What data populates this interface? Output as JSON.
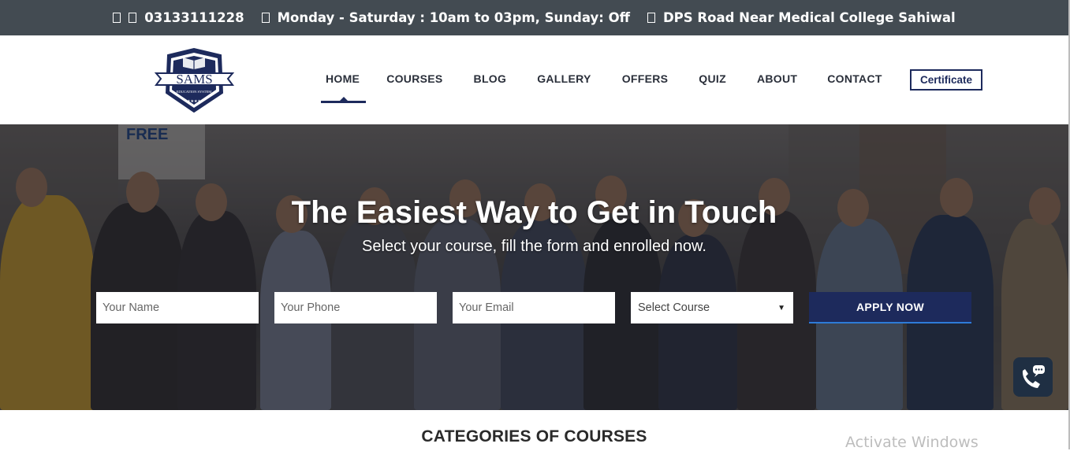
{
  "topbar": {
    "phone": "03133111228",
    "hours": "Monday - Saturday : 10am to 03pm, Sunday: Off",
    "address": "DPS Road Near Medical College Sahiwal"
  },
  "logo": {
    "title": "SAMS",
    "subtitle": "EDUCATION SYSTEM"
  },
  "nav": {
    "items": [
      "HOME",
      "COURSES",
      "BLOG",
      "GALLERY",
      "OFFERS",
      "QUIZ",
      "ABOUT",
      "CONTACT"
    ],
    "active": "HOME",
    "certificate_label": "Certificate"
  },
  "hero": {
    "title": "The Easiest Way to Get in Touch",
    "subtitle": "Select your course, fill the form and enrolled now.",
    "form": {
      "name_placeholder": "Your Name",
      "phone_placeholder": "Your Phone",
      "email_placeholder": "Your Email",
      "course_select": "Select Course",
      "submit_label": "APPLY NOW"
    },
    "banner_text": "FREE"
  },
  "section": {
    "title": "CATEGORIES OF COURSES"
  },
  "os_watermark": "Activate Windows",
  "colors": {
    "topbar_bg": "#434b52",
    "brand_navy": "#1d2a5c",
    "call_button_bg": "#1f2f43"
  },
  "icons": [
    "phone-icon",
    "whatsapp-icon",
    "clock-icon",
    "map-marker-icon",
    "call-chat-icon"
  ]
}
